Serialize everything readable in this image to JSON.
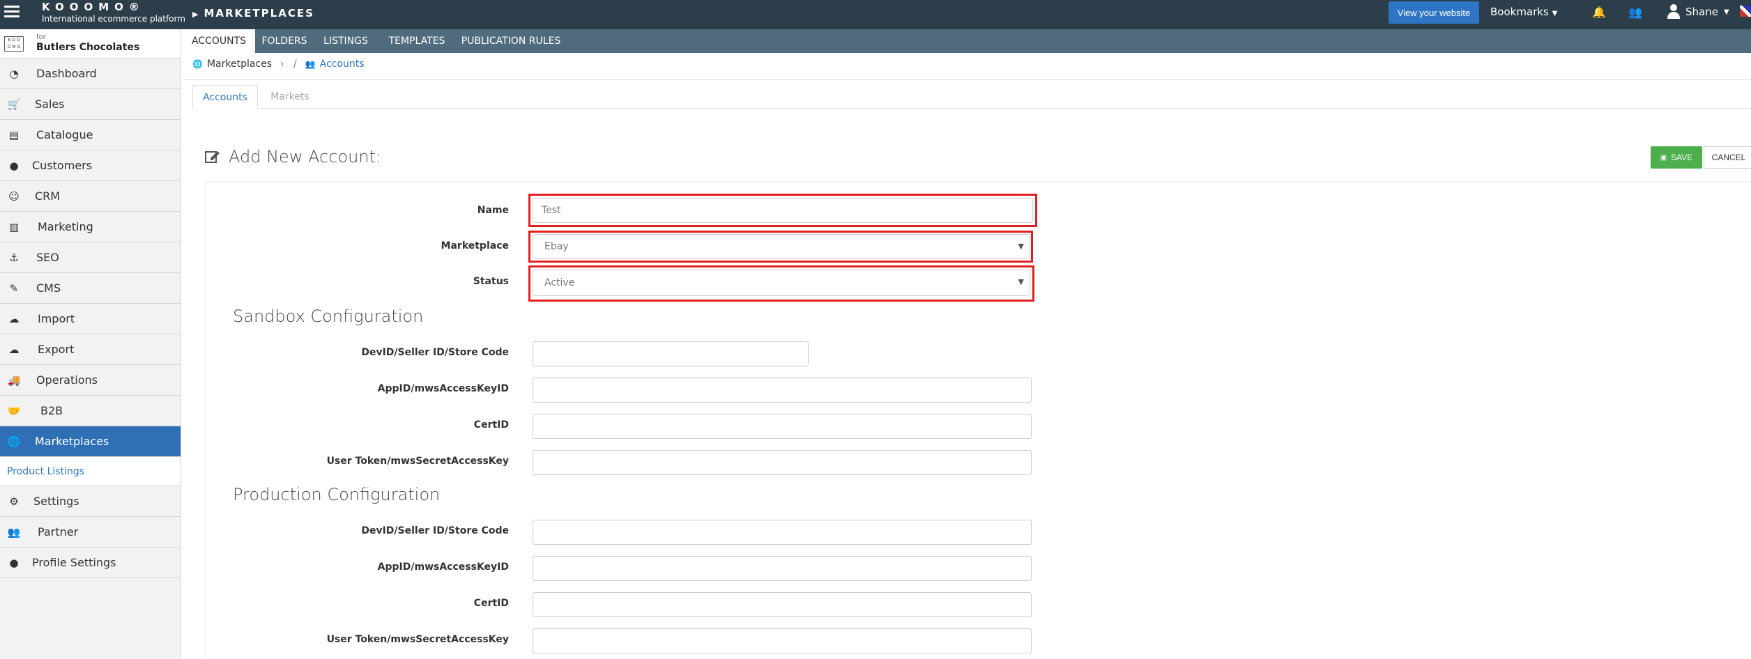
{
  "topbar": {
    "brand": "KOOOMO®",
    "tagline": "International ecommerce platform",
    "section": "MARKETPLACES",
    "view_website": "View your website",
    "bookmarks": "Bookmarks",
    "user": "Shane"
  },
  "subnav": {
    "tabs": [
      {
        "label": "ACCOUNTS"
      },
      {
        "label": "FOLDERS"
      },
      {
        "label": "LISTINGS"
      },
      {
        "label": "TEMPLATES"
      },
      {
        "label": "PUBLICATION RULES"
      }
    ]
  },
  "sidebar": {
    "client_for": "for",
    "client_name": "Butlers Chocolates",
    "items": [
      {
        "label": "Dashboard"
      },
      {
        "label": "Sales"
      },
      {
        "label": "Catalogue"
      },
      {
        "label": "Customers"
      },
      {
        "label": "CRM"
      },
      {
        "label": "Marketing"
      },
      {
        "label": "SEO"
      },
      {
        "label": "CMS"
      },
      {
        "label": "Import"
      },
      {
        "label": "Export"
      },
      {
        "label": "Operations"
      },
      {
        "label": "B2B"
      },
      {
        "label": "Marketplaces"
      }
    ],
    "sub_item": "Product Listings",
    "items_after": [
      {
        "label": "Settings"
      },
      {
        "label": "Partner"
      },
      {
        "label": "Profile Settings"
      }
    ]
  },
  "breadcrumb": {
    "root": "Marketplaces",
    "current": "Accounts"
  },
  "inner_tabs": {
    "accounts": "Accounts",
    "markets": "Markets"
  },
  "form": {
    "title": "Add New Account:",
    "save": "SAVE",
    "cancel": "CANCEL",
    "name_label": "Name",
    "name_value": "Test",
    "marketplace_label": "Marketplace",
    "marketplace_value": "Ebay",
    "status_label": "Status",
    "status_value": "Active",
    "sandbox_title": "Sandbox Configuration",
    "production_title": "Production Configuration",
    "devid_label": "DevID/Seller ID/Store Code",
    "appid_label": "AppID/mwsAccessKeyID",
    "certid_label": "CertID",
    "token_label": "User Token/mwsSecretAccessKey"
  },
  "colors": {
    "topbar": "#2c3e4a",
    "subnav": "#4f6b7d",
    "accent": "#2e76c5",
    "active_sidebar": "#2e6fb6",
    "save": "#4cae4c",
    "highlight": "#e02020"
  }
}
